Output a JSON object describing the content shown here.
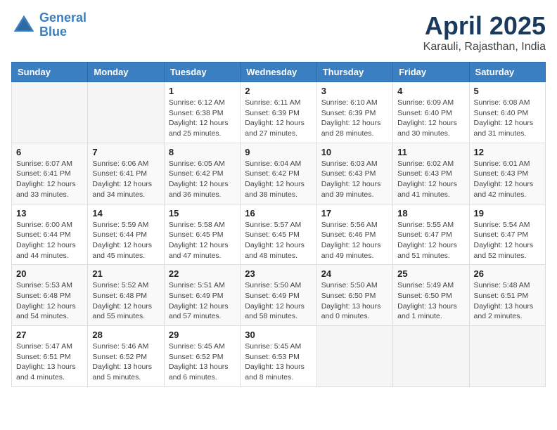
{
  "logo": {
    "line1": "General",
    "line2": "Blue"
  },
  "title": "April 2025",
  "location": "Karauli, Rajasthan, India",
  "weekdays": [
    "Sunday",
    "Monday",
    "Tuesday",
    "Wednesday",
    "Thursday",
    "Friday",
    "Saturday"
  ],
  "weeks": [
    [
      {
        "day": "",
        "info": ""
      },
      {
        "day": "",
        "info": ""
      },
      {
        "day": "1",
        "info": "Sunrise: 6:12 AM\nSunset: 6:38 PM\nDaylight: 12 hours and 25 minutes."
      },
      {
        "day": "2",
        "info": "Sunrise: 6:11 AM\nSunset: 6:39 PM\nDaylight: 12 hours and 27 minutes."
      },
      {
        "day": "3",
        "info": "Sunrise: 6:10 AM\nSunset: 6:39 PM\nDaylight: 12 hours and 28 minutes."
      },
      {
        "day": "4",
        "info": "Sunrise: 6:09 AM\nSunset: 6:40 PM\nDaylight: 12 hours and 30 minutes."
      },
      {
        "day": "5",
        "info": "Sunrise: 6:08 AM\nSunset: 6:40 PM\nDaylight: 12 hours and 31 minutes."
      }
    ],
    [
      {
        "day": "6",
        "info": "Sunrise: 6:07 AM\nSunset: 6:41 PM\nDaylight: 12 hours and 33 minutes."
      },
      {
        "day": "7",
        "info": "Sunrise: 6:06 AM\nSunset: 6:41 PM\nDaylight: 12 hours and 34 minutes."
      },
      {
        "day": "8",
        "info": "Sunrise: 6:05 AM\nSunset: 6:42 PM\nDaylight: 12 hours and 36 minutes."
      },
      {
        "day": "9",
        "info": "Sunrise: 6:04 AM\nSunset: 6:42 PM\nDaylight: 12 hours and 38 minutes."
      },
      {
        "day": "10",
        "info": "Sunrise: 6:03 AM\nSunset: 6:43 PM\nDaylight: 12 hours and 39 minutes."
      },
      {
        "day": "11",
        "info": "Sunrise: 6:02 AM\nSunset: 6:43 PM\nDaylight: 12 hours and 41 minutes."
      },
      {
        "day": "12",
        "info": "Sunrise: 6:01 AM\nSunset: 6:43 PM\nDaylight: 12 hours and 42 minutes."
      }
    ],
    [
      {
        "day": "13",
        "info": "Sunrise: 6:00 AM\nSunset: 6:44 PM\nDaylight: 12 hours and 44 minutes."
      },
      {
        "day": "14",
        "info": "Sunrise: 5:59 AM\nSunset: 6:44 PM\nDaylight: 12 hours and 45 minutes."
      },
      {
        "day": "15",
        "info": "Sunrise: 5:58 AM\nSunset: 6:45 PM\nDaylight: 12 hours and 47 minutes."
      },
      {
        "day": "16",
        "info": "Sunrise: 5:57 AM\nSunset: 6:45 PM\nDaylight: 12 hours and 48 minutes."
      },
      {
        "day": "17",
        "info": "Sunrise: 5:56 AM\nSunset: 6:46 PM\nDaylight: 12 hours and 49 minutes."
      },
      {
        "day": "18",
        "info": "Sunrise: 5:55 AM\nSunset: 6:47 PM\nDaylight: 12 hours and 51 minutes."
      },
      {
        "day": "19",
        "info": "Sunrise: 5:54 AM\nSunset: 6:47 PM\nDaylight: 12 hours and 52 minutes."
      }
    ],
    [
      {
        "day": "20",
        "info": "Sunrise: 5:53 AM\nSunset: 6:48 PM\nDaylight: 12 hours and 54 minutes."
      },
      {
        "day": "21",
        "info": "Sunrise: 5:52 AM\nSunset: 6:48 PM\nDaylight: 12 hours and 55 minutes."
      },
      {
        "day": "22",
        "info": "Sunrise: 5:51 AM\nSunset: 6:49 PM\nDaylight: 12 hours and 57 minutes."
      },
      {
        "day": "23",
        "info": "Sunrise: 5:50 AM\nSunset: 6:49 PM\nDaylight: 12 hours and 58 minutes."
      },
      {
        "day": "24",
        "info": "Sunrise: 5:50 AM\nSunset: 6:50 PM\nDaylight: 13 hours and 0 minutes."
      },
      {
        "day": "25",
        "info": "Sunrise: 5:49 AM\nSunset: 6:50 PM\nDaylight: 13 hours and 1 minute."
      },
      {
        "day": "26",
        "info": "Sunrise: 5:48 AM\nSunset: 6:51 PM\nDaylight: 13 hours and 2 minutes."
      }
    ],
    [
      {
        "day": "27",
        "info": "Sunrise: 5:47 AM\nSunset: 6:51 PM\nDaylight: 13 hours and 4 minutes."
      },
      {
        "day": "28",
        "info": "Sunrise: 5:46 AM\nSunset: 6:52 PM\nDaylight: 13 hours and 5 minutes."
      },
      {
        "day": "29",
        "info": "Sunrise: 5:45 AM\nSunset: 6:52 PM\nDaylight: 13 hours and 6 minutes."
      },
      {
        "day": "30",
        "info": "Sunrise: 5:45 AM\nSunset: 6:53 PM\nDaylight: 13 hours and 8 minutes."
      },
      {
        "day": "",
        "info": ""
      },
      {
        "day": "",
        "info": ""
      },
      {
        "day": "",
        "info": ""
      }
    ]
  ]
}
